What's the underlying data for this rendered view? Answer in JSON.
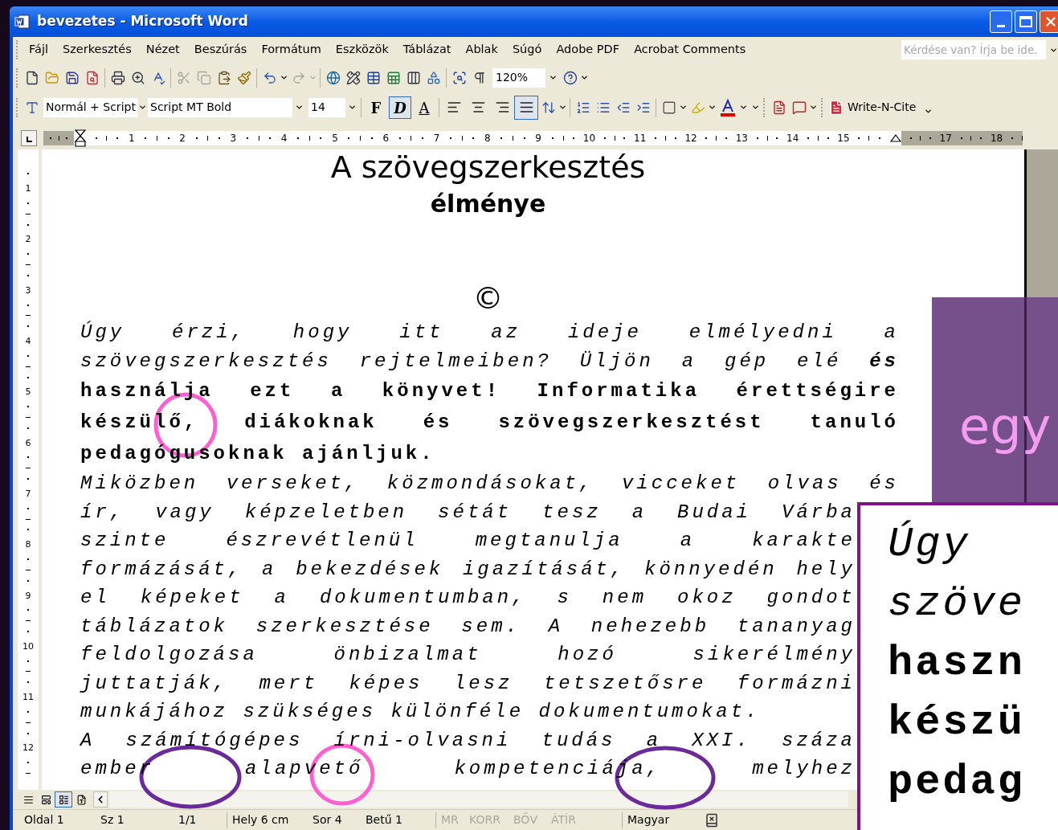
{
  "window": {
    "title": "bevezetes - Microsoft Word"
  },
  "menu": [
    "Fájl",
    "Szerkesztés",
    "Nézet",
    "Beszúrás",
    "Formátum",
    "Eszközök",
    "Táblázat",
    "Ablak",
    "Súgó",
    "Adobe PDF",
    "Acrobat Comments"
  ],
  "help_field": {
    "placeholder": "Kérdése van? Írja be ide."
  },
  "standard_toolbar": {
    "zoom": "120%"
  },
  "formatting_toolbar": {
    "style": "Normál + Script",
    "font": "Script MT Bold",
    "size": "14",
    "format_buttons": [
      {
        "label": "F",
        "kind": "bold",
        "selected": false
      },
      {
        "label": "D",
        "kind": "italic",
        "selected": true
      },
      {
        "label": "A",
        "kind": "underline",
        "selected": false
      }
    ],
    "alignment": [
      {
        "kind": "left",
        "selected": false
      },
      {
        "kind": "center",
        "selected": false
      },
      {
        "kind": "right",
        "selected": false
      },
      {
        "kind": "justify",
        "selected": true
      }
    ],
    "write_n_cite": "Write-N-Cite"
  },
  "ruler": {
    "horizontal": [
      "1",
      "2",
      "3",
      "4",
      "5",
      "6",
      "7",
      "8",
      "9",
      "10",
      "11",
      "12",
      "13",
      "14",
      "15",
      "17",
      "18"
    ],
    "vertical": [
      "1",
      "2",
      "3",
      "4",
      "5",
      "6",
      "7",
      "8",
      "9",
      "10",
      "11",
      "12"
    ]
  },
  "document": {
    "title": "A szövegszerkesztés",
    "subtitle": "élménye",
    "symbol": "©",
    "lines": [
      {
        "text": "Úgy érzi, hogy itt az ideje elmélyedni a",
        "kind": "italic",
        "justified": true
      },
      {
        "text": "szövegszerkesztés rejtelmeiben? Üljön a gép elé **és**",
        "kind": "italic",
        "justified": true
      },
      {
        "text": "használja ezt a könyvet! Informatika érettségire",
        "kind": "bold",
        "justified": true
      },
      {
        "text": "készülő, diákoknak és szövegszerkesztést tanuló",
        "kind": "bold",
        "justified": true
      },
      {
        "text": "pedagógusoknak ajánljuk.",
        "kind": "bold",
        "justified": false
      },
      {
        "text": "Miközben verseket, közmondásokat, vicceket olvas és",
        "kind": "italic",
        "justified": true
      },
      {
        "text": "ír, vagy képzeletben sétát tesz a Budai Várba",
        "kind": "italic",
        "justified": true
      },
      {
        "text": "szinte észrevétlenül megtanulja a karakte",
        "kind": "italic",
        "justified": true
      },
      {
        "text": "formázását, a bekezdések igazítását, könnyedén hely",
        "kind": "italic",
        "justified": true
      },
      {
        "text": "el képeket a dokumentumban, s nem okoz gondot",
        "kind": "italic",
        "justified": true
      },
      {
        "text": "táblázatok szerkesztése sem. A nehezebb tananyag",
        "kind": "italic",
        "justified": true
      },
      {
        "text": "feldolgozása önbizalmat hozó sikerélmény",
        "kind": "italic",
        "justified": true
      },
      {
        "text": "juttatják, mert képes lesz tetszetősre formázni",
        "kind": "italic",
        "justified": true
      },
      {
        "text": "munkájához szükséges különféle dokumentumokat.",
        "kind": "italic",
        "justified": false
      },
      {
        "text": "A számítógépes írni-olvasni tudás a XXI. száza",
        "kind": "italic",
        "justified": true
      },
      {
        "text": "ember alapvető kompetenciája, melyhez",
        "kind": "italic",
        "justified": true
      }
    ]
  },
  "side_panel": {
    "text": "egy"
  },
  "magnifier": {
    "lines": [
      {
        "text": "Úgy",
        "kind": "italic"
      },
      {
        "text": "szöve",
        "kind": "italic"
      },
      {
        "text": "haszn",
        "kind": "bold"
      },
      {
        "text": "készü",
        "kind": "bold"
      },
      {
        "text": "pedag",
        "kind": "bold"
      }
    ]
  },
  "view_buttons": [
    {
      "selected": false
    },
    {
      "selected": false
    },
    {
      "selected": true
    },
    {
      "selected": false
    }
  ],
  "status_bar": [
    {
      "text": "Oldal 1",
      "disabled": false
    },
    {
      "text": "Sz 1",
      "disabled": false
    },
    {
      "text": "1/1",
      "disabled": false
    },
    {
      "text": "Hely 6 cm",
      "disabled": false
    },
    {
      "text": "Sor 4",
      "disabled": false
    },
    {
      "text": "Betű 1",
      "disabled": false
    },
    {
      "text": "MR",
      "disabled": true
    },
    {
      "text": "KORR",
      "disabled": true
    },
    {
      "text": "BŐV",
      "disabled": true
    },
    {
      "text": "ÁTÍR",
      "disabled": true
    },
    {
      "text": "Magyar",
      "disabled": false
    }
  ]
}
